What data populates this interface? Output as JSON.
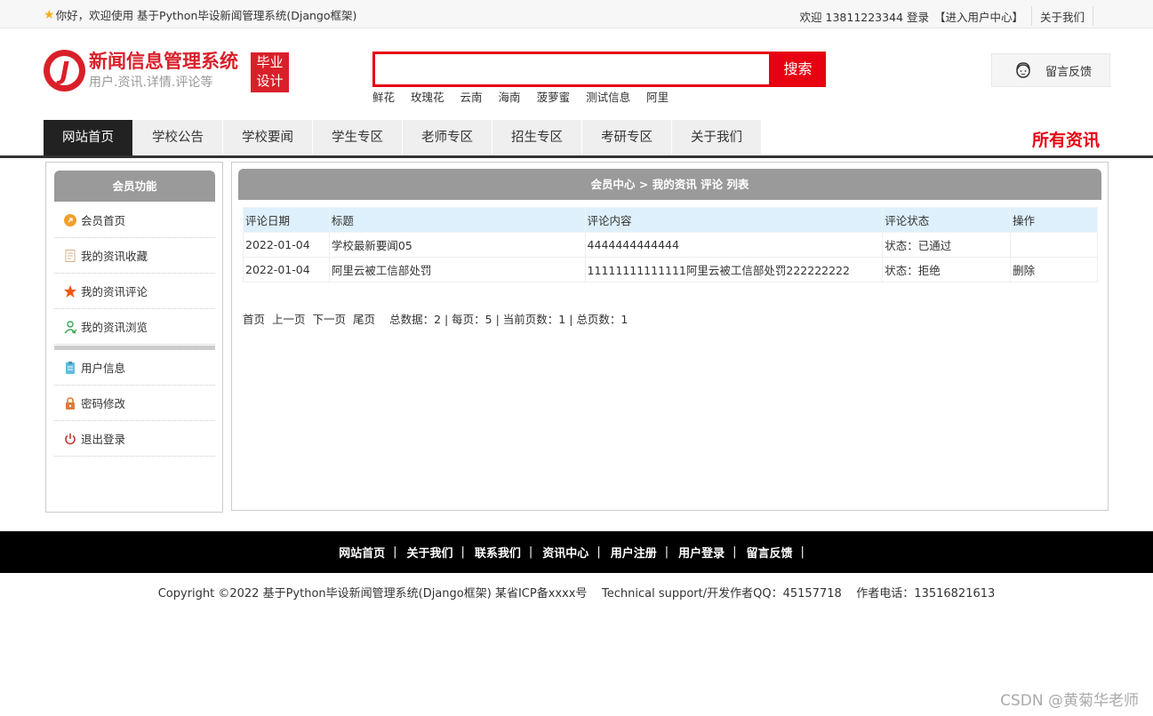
{
  "topbar": {
    "welcome": "你好，欢迎使用 基于Python毕设新闻管理系统(Django框架)",
    "user_welcome": "欢迎 13811223344 登录",
    "user_center": "【进入用户中心】",
    "about": "关于我们"
  },
  "logo": {
    "title": "新闻信息管理系统",
    "subtitle": "用户.资讯.详情.评论等",
    "badge_line1": "毕业",
    "badge_line2": "设计"
  },
  "search": {
    "value": "",
    "placeholder": "",
    "button_label": "搜索",
    "hot_words": [
      "鲜花",
      "玫瑰花",
      "云南",
      "海南",
      "菠萝蜜",
      "测试信息",
      "阿里"
    ]
  },
  "feedback": {
    "label": "留言反馈"
  },
  "nav": {
    "items": [
      "网站首页",
      "学校公告",
      "学校要闻",
      "学生专区",
      "老师专区",
      "招生专区",
      "考研专区",
      "关于我们"
    ],
    "active_index": 0,
    "all_news": "所有资讯"
  },
  "sidebar": {
    "title": "会员功能",
    "group1": [
      {
        "label": "会员首页",
        "icon": "home-icon"
      },
      {
        "label": "我的资讯收藏",
        "icon": "document-icon"
      },
      {
        "label": "我的资讯评论",
        "icon": "star-icon"
      },
      {
        "label": "我的资讯浏览",
        "icon": "user-browse-icon"
      }
    ],
    "group2": [
      {
        "label": "用户信息",
        "icon": "clipboard-icon"
      },
      {
        "label": "密码修改",
        "icon": "lock-icon"
      },
      {
        "label": "退出登录",
        "icon": "power-icon"
      }
    ]
  },
  "main": {
    "title": "会员中心 > 我的资讯 评论 列表",
    "columns": [
      "评论日期",
      "标题",
      "评论内容",
      "评论状态",
      "操作"
    ],
    "rows": [
      {
        "date": "2022-01-04",
        "title": "学校最新要闻05",
        "content": "4444444444444",
        "status": "状态：已通过",
        "action": ""
      },
      {
        "date": "2022-01-04",
        "title": "阿里云被工信部处罚",
        "content": "11111111111111阿里云被工信部处罚222222222",
        "status": "状态：拒绝",
        "action": "删除"
      }
    ],
    "pager": {
      "first": "首页",
      "prev": "上一页",
      "next": "下一页",
      "last": "尾页",
      "stats": "总数据：2 | 每页：5 | 当前页数：1 | 总页数：1"
    }
  },
  "footer": {
    "links": [
      "网站首页",
      "关于我们",
      "联系我们",
      "资讯中心",
      "用户注册",
      "用户登录",
      "留言反馈"
    ],
    "copyright": "Copyright ©2022 基于Python毕设新闻管理系统(Django框架) 某省ICP备xxxx号    Technical support/开发作者QQ：45157718    作者电话：13516821613",
    "watermark": "CSDN @黄菊华老师"
  },
  "colors": {
    "brand_red": "#e60012",
    "nav_active": "#222222",
    "panel_header": "#9a9a9a",
    "table_header": "#def0fb",
    "footer_bg": "#000000"
  }
}
